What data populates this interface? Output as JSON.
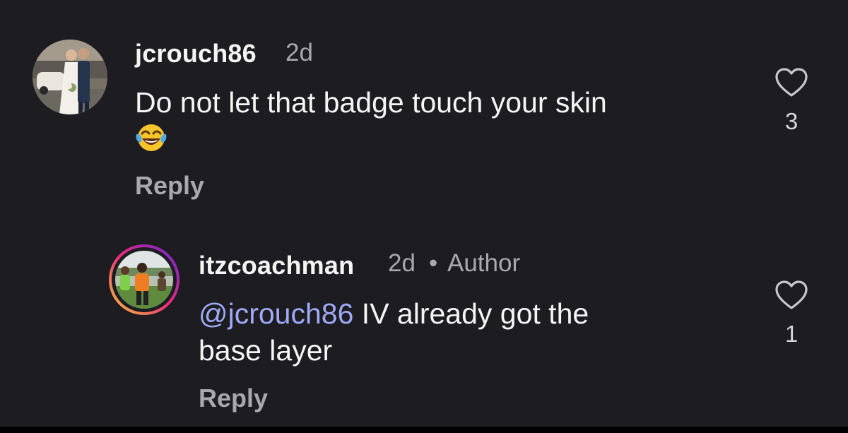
{
  "comments": [
    {
      "username": "jcrouch86",
      "time": "2d",
      "text": "Do not let that badge touch your skin",
      "emoji": "😂",
      "emoji_name": "face-with-tears-of-joy",
      "reply_label": "Reply",
      "likes": "3",
      "avatar_icon": "profile-photo-couple"
    },
    {
      "username": "itzcoachman",
      "time": "2d",
      "separator": "•",
      "author_label": "Author",
      "mention": "@jcrouch86",
      "text_line1": " IV already got the",
      "text_line2": "base layer",
      "reply_label": "Reply",
      "likes": "1",
      "avatar_icon": "profile-photo-coach",
      "colors": {
        "story_ring_start": "#f9ce34",
        "story_ring_mid": "#ee2a7b",
        "story_ring_end": "#6228d7"
      }
    }
  ]
}
